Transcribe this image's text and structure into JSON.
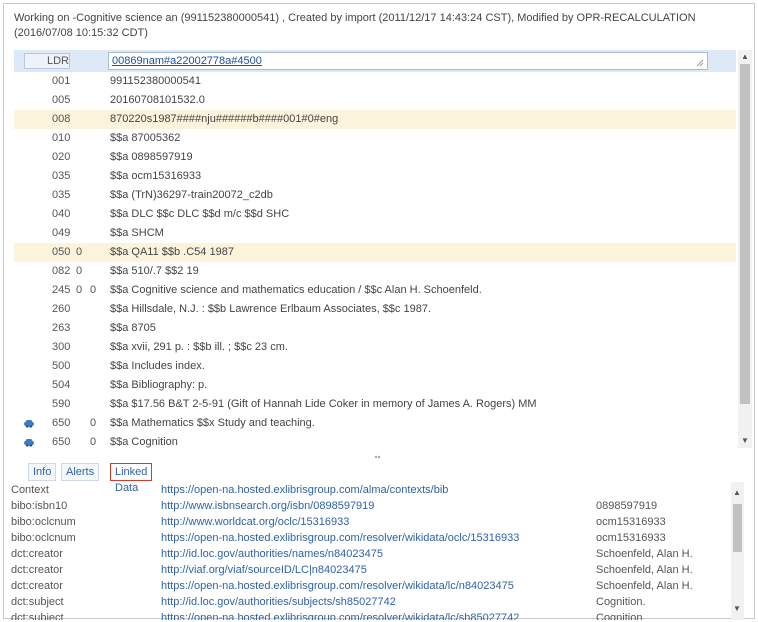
{
  "header": {
    "text": "Working on -Cognitive science an (991152380000541) , Created by import (2011/12/17 14:43:24 CST), Modified by OPR-RECALCULATION (2016/07/08 10:15:32 CDT)"
  },
  "ldr": {
    "tag": "LDR",
    "value": "00869nam#a22002778a#4500"
  },
  "fields": [
    {
      "tag": "001",
      "ind1": "",
      "ind2": "",
      "value": "991152380000541",
      "highlight": false
    },
    {
      "tag": "005",
      "ind1": "",
      "ind2": "",
      "value": "20160708101532.0",
      "highlight": false
    },
    {
      "tag": "008",
      "ind1": "",
      "ind2": "",
      "value": "870220s1987####nju######b####001#0#eng",
      "highlight": true
    },
    {
      "tag": "010",
      "ind1": "",
      "ind2": "",
      "value": "$$a 87005362",
      "highlight": false
    },
    {
      "tag": "020",
      "ind1": "",
      "ind2": "",
      "value": "$$a 0898597919",
      "highlight": false
    },
    {
      "tag": "035",
      "ind1": "",
      "ind2": "",
      "value": "$$a ocm15316933",
      "highlight": false
    },
    {
      "tag": "035",
      "ind1": "",
      "ind2": "",
      "value": "$$a (TrN)36297-train20072_c2db",
      "highlight": false
    },
    {
      "tag": "040",
      "ind1": "",
      "ind2": "",
      "value": "$$a DLC $$c DLC $$d m/c $$d SHC",
      "highlight": false
    },
    {
      "tag": "049",
      "ind1": "",
      "ind2": "",
      "value": "$$a SHCM",
      "highlight": false
    },
    {
      "tag": "050",
      "ind1": "0",
      "ind2": "",
      "value": "$$a QA11 $$b .C54 1987",
      "highlight": true
    },
    {
      "tag": "082",
      "ind1": "0",
      "ind2": "",
      "value": "$$a 510/.7 $$2 19",
      "highlight": false
    },
    {
      "tag": "245",
      "ind1": "0",
      "ind2": "0",
      "value": "$$a Cognitive science and mathematics education / $$c Alan H. Schoenfeld.",
      "highlight": false
    },
    {
      "tag": "260",
      "ind1": "",
      "ind2": "",
      "value": "$$a Hillsdale, N.J. : $$b Lawrence Erlbaum Associates, $$c 1987.",
      "highlight": false
    },
    {
      "tag": "263",
      "ind1": "",
      "ind2": "",
      "value": "$$a 8705",
      "highlight": false
    },
    {
      "tag": "300",
      "ind1": "",
      "ind2": "",
      "value": "$$a xvii, 291 p. : $$b ill. ; $$c 23 cm.",
      "highlight": false
    },
    {
      "tag": "500",
      "ind1": "",
      "ind2": "",
      "value": "$$a Includes index.",
      "highlight": false
    },
    {
      "tag": "504",
      "ind1": "",
      "ind2": "",
      "value": "$$a Bibliography: p.",
      "highlight": false
    },
    {
      "tag": "590",
      "ind1": "",
      "ind2": "",
      "value": "$$a $17.56 B&T 2-5-91 (Gift of Hannah Lide Coker in memory of James A. Rogers) MM",
      "highlight": false
    },
    {
      "tag": "650",
      "ind1": "",
      "ind2": "0",
      "value": "$$a Mathematics $$x Study and teaching.",
      "highlight": false,
      "icon": "link-icon"
    },
    {
      "tag": "650",
      "ind1": "",
      "ind2": "0",
      "value": "$$a Cognition",
      "highlight": false,
      "icon": "link-icon"
    }
  ],
  "tabs": [
    {
      "label": "Info",
      "active": false
    },
    {
      "label": "Alerts",
      "active": false
    },
    {
      "label": "Linked Data",
      "active": true
    }
  ],
  "linked_data": [
    {
      "key": "Context",
      "uri": "https://open-na.hosted.exlibrisgroup.com/alma/contexts/bib",
      "value": ""
    },
    {
      "key": "bibo:isbn10",
      "uri": "http://www.isbnsearch.org/isbn/0898597919",
      "value": "0898597919"
    },
    {
      "key": "bibo:oclcnum",
      "uri": "http://www.worldcat.org/oclc/15316933",
      "value": "ocm15316933"
    },
    {
      "key": "bibo:oclcnum",
      "uri": "https://open-na.hosted.exlibrisgroup.com/resolver/wikidata/oclc/15316933",
      "value": "ocm15316933"
    },
    {
      "key": "dct:creator",
      "uri": "http://id.loc.gov/authorities/names/n84023475",
      "value": "Schoenfeld, Alan H."
    },
    {
      "key": "dct:creator",
      "uri": "http://viaf.org/viaf/sourceID/LC|n84023475",
      "value": "Schoenfeld, Alan H."
    },
    {
      "key": "dct:creator",
      "uri": "https://open-na.hosted.exlibrisgroup.com/resolver/wikidata/lc/n84023475",
      "value": "Schoenfeld, Alan H."
    },
    {
      "key": "dct:subject",
      "uri": "http://id.loc.gov/authorities/subjects/sh85027742",
      "value": "Cognition."
    },
    {
      "key": "dct:subject",
      "uri": "https://open-na.hosted.exlibrisgroup.com/resolver/wikidata/lc/sh85027742",
      "value": "Cognition."
    }
  ],
  "colors": {
    "highlight": "#fcf3dc",
    "ldr_row": "#dde9f6",
    "link": "#2f62a8",
    "active_tab_border": "#d33b2e"
  }
}
